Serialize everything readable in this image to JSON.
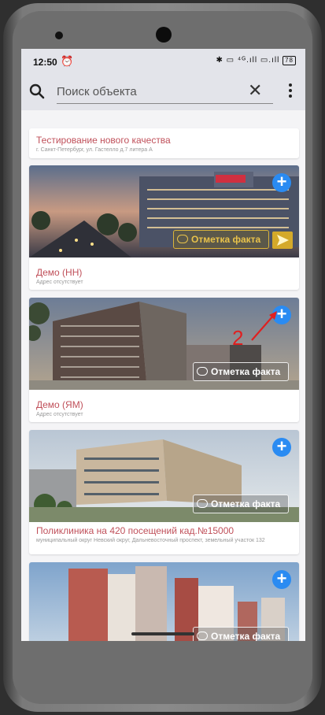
{
  "status_bar": {
    "time": "12:50",
    "alarm_icon": "alarm-icon",
    "indicators": "✱ ▭ ⁴ᴳ.ıll ▭.ıll",
    "battery": "78"
  },
  "search": {
    "placeholder": "Поиск объекта",
    "clear_icon": "close-icon",
    "menu_icon": "more-vert-icon"
  },
  "objects": [
    {
      "title": "Тестирование нового качества",
      "address": "г. Санкт-Петербург, ул. Гастелло д.7 литера А"
    },
    {
      "title": "Демо (НН)",
      "address": "Адрес отсутствует",
      "fact_label": "Отметка факта"
    },
    {
      "title": "Демо (ЯМ)",
      "address": "Адрес отсутствует",
      "fact_label": "Отметка факта"
    },
    {
      "title": "Поликлиника на 420 посещений кад.№15000",
      "address": "муниципальный округ Невский округ, Дальневосточный проспект, земельный участок 132",
      "fact_label": "Отметка факта"
    },
    {
      "title": "",
      "address": "",
      "fact_label": "Отметка факта"
    }
  ],
  "annotation": {
    "number": "2"
  },
  "colors": {
    "accent": "#2a8bf2",
    "title": "#c0505a",
    "highlight": "#d4a92a",
    "annotation": "#e02020"
  }
}
